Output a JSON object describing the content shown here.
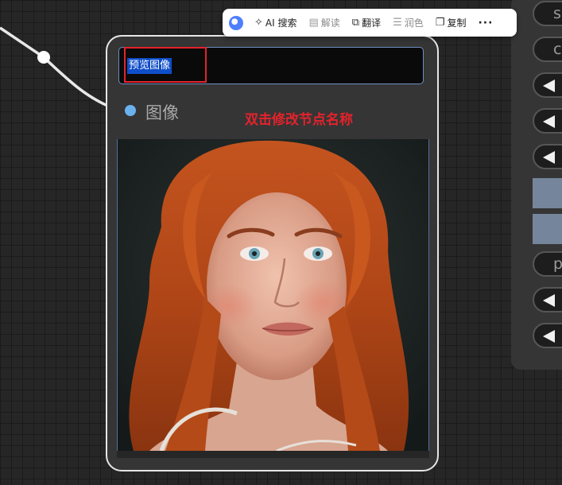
{
  "toolbar": {
    "ai_search": "AI 搜索",
    "explain": "解读",
    "translate": "翻译",
    "polish": "润色",
    "copy": "复制",
    "more": "···"
  },
  "node": {
    "title": "预览图像",
    "input_slot_label": "图像",
    "annotation": "双击修改节点名称"
  },
  "side_panel": {
    "pill_texts": [
      "s",
      "c",
      "p"
    ]
  },
  "colors": {
    "slot_dot": "#6ab2ee",
    "annotation_red": "#e5222b",
    "title_highlight": "#0f4ec9",
    "swatch": "#75859b"
  }
}
